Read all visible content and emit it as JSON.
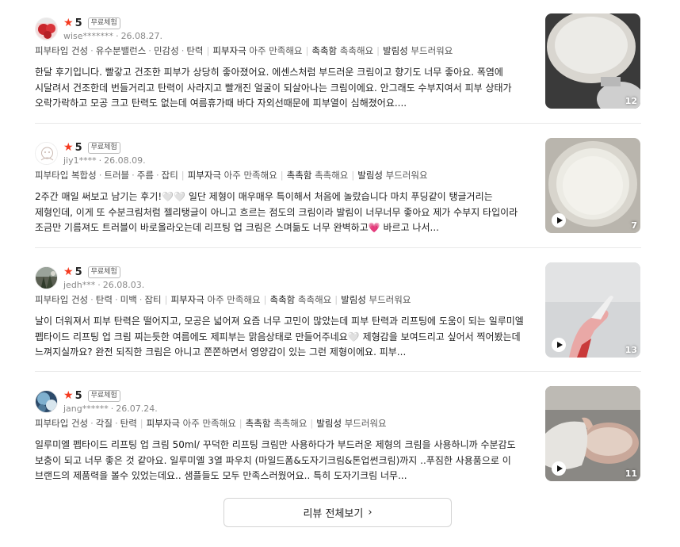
{
  "reviews": [
    {
      "rating": "5",
      "badge": "무료체험",
      "user": "wise*******",
      "date": "26.08.27.",
      "skin": [
        "피부타입 건성",
        "유수분밸런스",
        "민감성",
        "탄력"
      ],
      "eval": [
        {
          "k": "피부자극",
          "v": "아주 만족해요"
        },
        {
          "k": "촉촉함",
          "v": "촉촉해요"
        },
        {
          "k": "발림성",
          "v": "부드러워요"
        }
      ],
      "text": "한달 후기입니다. 빨갛고 건조한 피부가 상당히 좋아졌어요. 에센스처럼 부드러운 크림이고 향기도 너무 좋아요. 폭염에 시달려서 건조한데 번들거리고 탄력이 사라지고 빨개진 얼굴이 되살아나는 크림이에요. 안그래도 수부지여서 피부 상태가 오락가락하고 모공 크고 탄력도 없는데 여름휴가때 바다 자외선때문에 피부열이 심해졌어요....",
      "photo_count": "12"
    },
    {
      "rating": "5",
      "badge": "무료체험",
      "user": "jiy1****",
      "date": "26.08.09.",
      "skin": [
        "피부타입 복합성",
        "트러블",
        "주름",
        "잡티"
      ],
      "eval": [
        {
          "k": "피부자극",
          "v": "아주 만족해요"
        },
        {
          "k": "촉촉함",
          "v": "촉촉해요"
        },
        {
          "k": "발림성",
          "v": "부드러워요"
        }
      ],
      "text": "2주간 매일 써보고 남기는 후기!🤍🤍 일단 제형이 매우매우 특이해서 처음에 놀랐습니다 마치 푸딩같이 탱글거리는 제형인데, 이게 또 수분크림처럼 젤리탱글이 아니고 흐르는 점도의 크림이라 발림이 너무너무 좋아요 제가 수부지 타입이라 조금만 기름져도 트러블이 바로올라오는데 리프팅 업 크림은 스며듦도 너무 완벽하고💗 바르고 나서...",
      "photo_count": "7"
    },
    {
      "rating": "5",
      "badge": "무료체험",
      "user": "jedh***",
      "date": "26.08.03.",
      "skin": [
        "피부타입 건성",
        "탄력",
        "미백",
        "잡티"
      ],
      "eval": [
        {
          "k": "피부자극",
          "v": "아주 만족해요"
        },
        {
          "k": "촉촉함",
          "v": "촉촉해요"
        },
        {
          "k": "발림성",
          "v": "부드러워요"
        }
      ],
      "text": "날이 더워져서 피부 탄력은 떨어지고, 모공은 넓어져 요즘 너무 고민이 많았는데 피부 탄력과 리프팅에 도움이 되는 일루미엘 펩타이드 리프팅 업 크림 찌는듯한 여름에도 제피부는 맑음상태로 만들어주네요🤍 제형감을 보여드리고 싶어서 찍어봤는데 느껴지실까요? 완전 되직한 크림은 아니고 쫀쫀하면서 영양감이 있는 그런 제형이에요. 피부...",
      "photo_count": "13"
    },
    {
      "rating": "5",
      "badge": "무료체험",
      "user": "jang******",
      "date": "26.07.24.",
      "skin": [
        "피부타입 건성",
        "각질",
        "탄력"
      ],
      "eval": [
        {
          "k": "피부자극",
          "v": "아주 만족해요"
        },
        {
          "k": "촉촉함",
          "v": "촉촉해요"
        },
        {
          "k": "발림성",
          "v": "부드러워요"
        }
      ],
      "text": "일루미엘 펩타이드 리프팅 업 크림 50ml/ 꾸덕한 리프팅 크림만 사용하다가 부드러운 제형의 크림을 사용하니까 수분감도 보충이 되고 너무 좋은 것 같아요. 일루미엘 3열 파우치 (마일드폼&도자기크림&톤업썬크림)까지 ..푸짐한 사용품으로 이 브랜드의 제품력을 볼수 있었는데요.. 샘플들도 모두 만족스러웠어요.. 특히 도자기크림 너무...",
      "photo_count": "11"
    }
  ],
  "more_button": {
    "label": "리뷰 전체보기",
    "chevron": "›"
  },
  "colors": {
    "star": "#f53a1f",
    "text": "#222222",
    "divider": "#e9e9e9"
  }
}
